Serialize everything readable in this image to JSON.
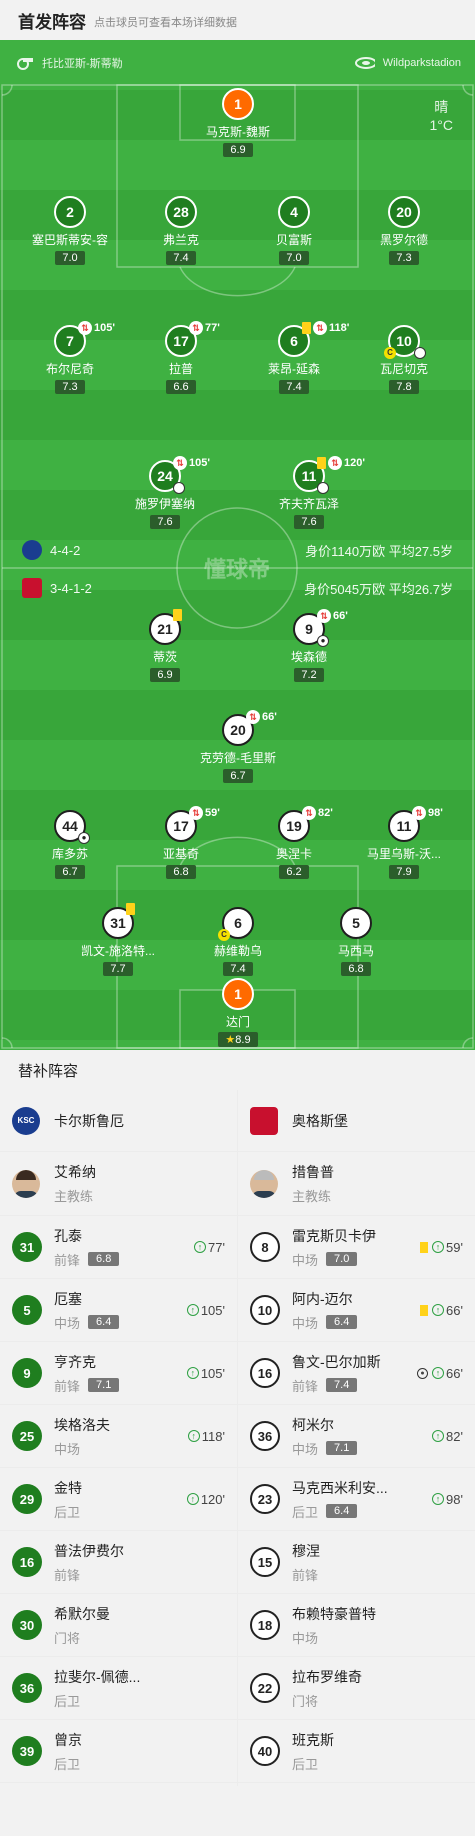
{
  "header": {
    "title": "首发阵容",
    "hint": "点击球员可查看本场详细数据"
  },
  "match": {
    "referee": "托比亚斯-斯蒂勒",
    "stadium": "Wildparkstadion",
    "weather_desc": "晴",
    "temperature": "1°C"
  },
  "home": {
    "formation": "4-4-2",
    "value_age": "身价1140万欧 平均27.5岁",
    "team_name": "卡尔斯鲁厄",
    "logo_text": "KSC",
    "color": "#1f7e1f",
    "players": [
      {
        "num": "1",
        "name": "马克斯-魏斯",
        "rating": "6.9",
        "gk": true
      },
      {
        "num": "2",
        "name": "塞巴斯蒂安-容",
        "rating": "7.0"
      },
      {
        "num": "28",
        "name": "弗兰克",
        "rating": "7.4"
      },
      {
        "num": "4",
        "name": "贝富斯",
        "rating": "7.0"
      },
      {
        "num": "20",
        "name": "黑罗尔德",
        "rating": "7.3"
      },
      {
        "num": "7",
        "name": "布尔尼奇",
        "rating": "7.3",
        "sub": "105'"
      },
      {
        "num": "17",
        "name": "拉普",
        "rating": "6.6",
        "sub": "77'"
      },
      {
        "num": "6",
        "name": "莱昂-延森",
        "rating": "7.4",
        "sub": "118'"
      },
      {
        "num": "10",
        "name": "瓦尼切克",
        "rating": "7.8"
      },
      {
        "num": "24",
        "name": "施罗伊塞纳",
        "rating": "7.6",
        "sub": "105'"
      },
      {
        "num": "11",
        "name": "齐夫齐瓦泽",
        "rating": "7.6",
        "sub": "120'"
      }
    ]
  },
  "away": {
    "formation": "3-4-1-2",
    "value_age": "身价5045万欧 平均26.7岁",
    "team_name": "奥格斯堡",
    "color": "#c8102e",
    "players": [
      {
        "num": "21",
        "name": "蒂茨",
        "rating": "6.9"
      },
      {
        "num": "9",
        "name": "埃森德",
        "rating": "7.2",
        "sub": "66'"
      },
      {
        "num": "20",
        "name": "克劳德-毛里斯",
        "rating": "6.7",
        "sub": "66'"
      },
      {
        "num": "44",
        "name": "库多苏",
        "rating": "6.7"
      },
      {
        "num": "17",
        "name": "亚基奇",
        "rating": "6.8",
        "sub": "59'"
      },
      {
        "num": "19",
        "name": "奥涅卡",
        "rating": "6.2",
        "sub": "82'"
      },
      {
        "num": "11",
        "name": "马里乌斯-沃...",
        "rating": "7.9",
        "sub": "98'"
      },
      {
        "num": "31",
        "name": "凯文-施洛特...",
        "rating": "7.7"
      },
      {
        "num": "6",
        "name": "赫维勒乌",
        "rating": "7.4"
      },
      {
        "num": "5",
        "name": "马西马",
        "rating": "6.8"
      },
      {
        "num": "1",
        "name": "达门",
        "rating": "8.9",
        "gk": true
      }
    ]
  },
  "subs": {
    "title": "替补阵容",
    "home_coach": {
      "name": "艾希纳",
      "role": "主教练"
    },
    "away_coach": {
      "name": "措鲁普",
      "role": "主教练"
    },
    "home": [
      {
        "num": "31",
        "name": "孔泰",
        "pos": "前锋",
        "rating": "6.8",
        "time": "77'"
      },
      {
        "num": "5",
        "name": "厄塞",
        "pos": "中场",
        "rating": "6.4",
        "time": "105'"
      },
      {
        "num": "9",
        "name": "亨齐克",
        "pos": "前锋",
        "rating": "7.1",
        "time": "105'"
      },
      {
        "num": "25",
        "name": "埃格洛夫",
        "pos": "中场",
        "time": "118'"
      },
      {
        "num": "29",
        "name": "金特",
        "pos": "后卫",
        "time": "120'"
      },
      {
        "num": "16",
        "name": "普法伊费尔",
        "pos": "前锋"
      },
      {
        "num": "30",
        "name": "希默尔曼",
        "pos": "门将"
      },
      {
        "num": "36",
        "name": "拉斐尔-佩德...",
        "pos": "后卫"
      },
      {
        "num": "39",
        "name": "曾京",
        "pos": "后卫"
      }
    ],
    "away": [
      {
        "num": "8",
        "name": "雷克斯贝卡伊",
        "pos": "中场",
        "rating": "7.0",
        "time": "59'"
      },
      {
        "num": "10",
        "name": "阿内-迈尔",
        "pos": "中场",
        "rating": "6.4",
        "time": "66'"
      },
      {
        "num": "16",
        "name": "鲁文-巴尔加斯",
        "pos": "前锋",
        "rating": "7.4",
        "time": "66'"
      },
      {
        "num": "36",
        "name": "柯米尔",
        "pos": "中场",
        "rating": "7.1",
        "time": "82'"
      },
      {
        "num": "23",
        "name": "马克西米利安...",
        "pos": "后卫",
        "rating": "6.4",
        "time": "98'"
      },
      {
        "num": "15",
        "name": "穆涅",
        "pos": "前锋"
      },
      {
        "num": "18",
        "name": "布赖特豪普特",
        "pos": "中场"
      },
      {
        "num": "22",
        "name": "拉布罗维奇",
        "pos": "门将"
      },
      {
        "num": "40",
        "name": "班克斯",
        "pos": "后卫"
      }
    ]
  },
  "watermark": "懂球帝",
  "icons": {
    "referee": "whistle-icon",
    "stadium": "stadium-icon",
    "substitution": "substitution-icon",
    "goal": "ball-icon",
    "yellow_card": "yellow-card-icon",
    "captain": "captain-icon",
    "star": "star-icon"
  }
}
